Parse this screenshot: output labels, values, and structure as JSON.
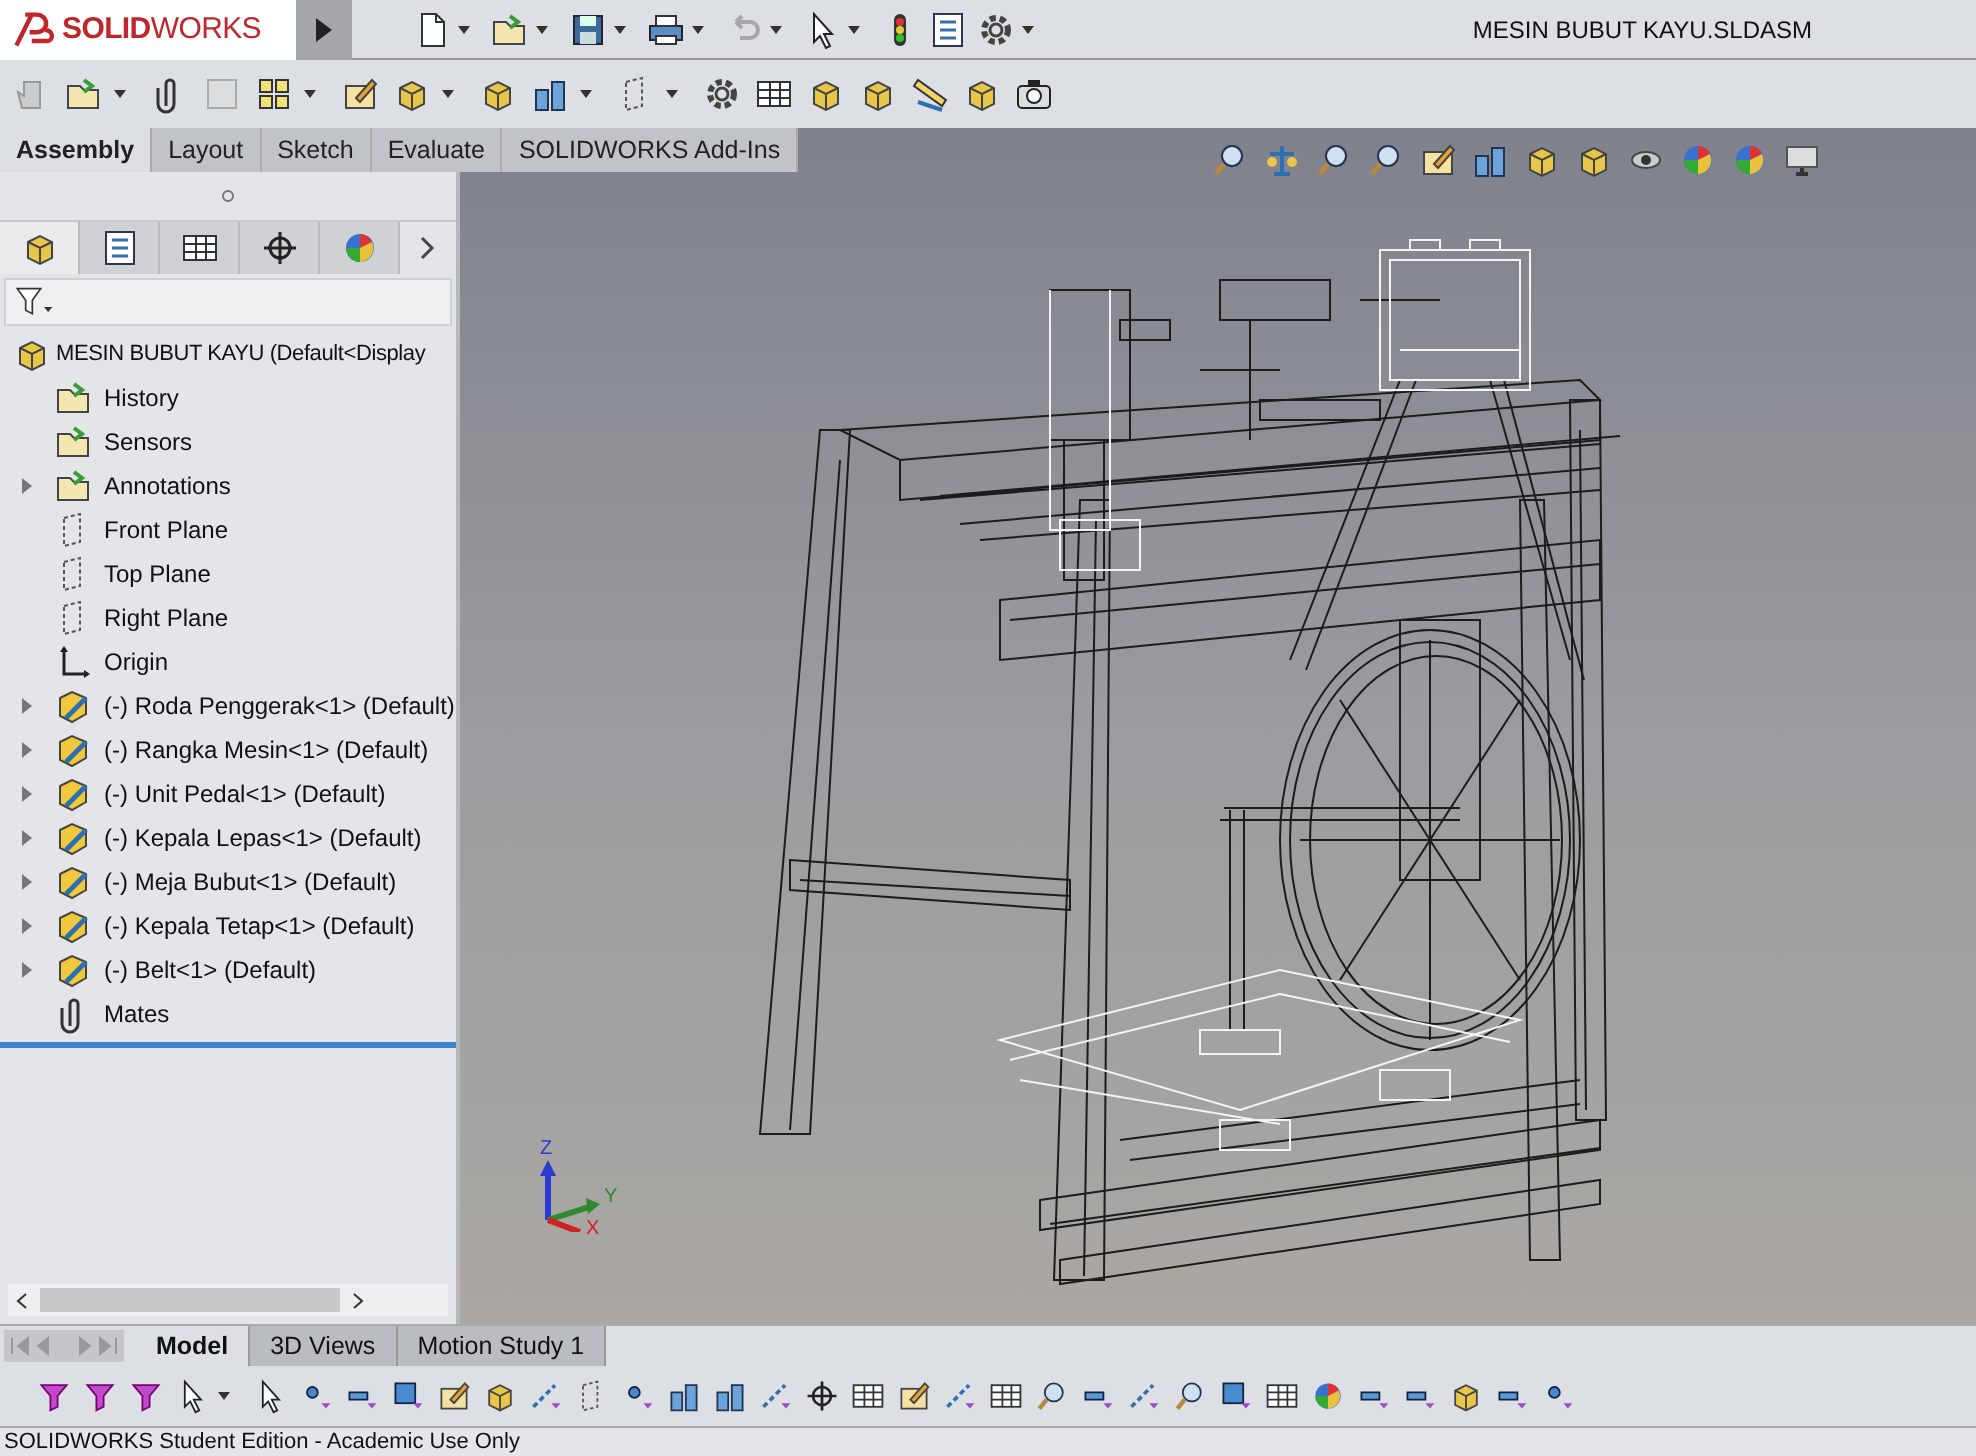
{
  "app": {
    "logo": "**SOLID**WORKS"
  },
  "window": {
    "title": "MESIN BUBUT KAYU.SLDASM"
  },
  "command_tabs": [
    {
      "label": "Assembly",
      "selected": true
    },
    {
      "label": "Layout",
      "selected": false
    },
    {
      "label": "Sketch",
      "selected": false
    },
    {
      "label": "Evaluate",
      "selected": false
    },
    {
      "label": "SOLIDWORKS Add-Ins",
      "selected": false
    }
  ],
  "panel_tabs": [
    {
      "kind": "feature",
      "selected": true
    },
    {
      "kind": "property",
      "selected": false
    },
    {
      "kind": "config",
      "selected": false
    },
    {
      "kind": "dimxpert",
      "selected": false
    },
    {
      "kind": "display",
      "selected": false
    }
  ],
  "tree": {
    "root": "MESIN BUBUT KAYU  (Default<Display",
    "items": [
      {
        "kind": "history",
        "label": "History",
        "expandable": false
      },
      {
        "kind": "sensors",
        "label": "Sensors",
        "expandable": false
      },
      {
        "kind": "annotations",
        "label": "Annotations",
        "expandable": true
      },
      {
        "kind": "plane",
        "label": "Front Plane",
        "expandable": false
      },
      {
        "kind": "plane",
        "label": "Top Plane",
        "expandable": false
      },
      {
        "kind": "plane",
        "label": "Right Plane",
        "expandable": false
      },
      {
        "kind": "origin",
        "label": "Origin",
        "expandable": false
      },
      {
        "kind": "component",
        "label": "(-) Roda Penggerak<1> (Default)",
        "expandable": true
      },
      {
        "kind": "component",
        "label": "(-) Rangka Mesin<1> (Default)",
        "expandable": true
      },
      {
        "kind": "component",
        "label": "(-) Unit Pedal<1> (Default)",
        "expandable": true
      },
      {
        "kind": "component",
        "label": "(-) Kepala Lepas<1> (Default)",
        "expandable": true
      },
      {
        "kind": "component",
        "label": "(-) Meja Bubut<1> (Default)",
        "expandable": true
      },
      {
        "kind": "component",
        "label": "(-) Kepala Tetap<1> (Default)",
        "expandable": true
      },
      {
        "kind": "component",
        "label": "(-) Belt<1> (Default)",
        "expandable": true
      },
      {
        "kind": "mates",
        "label": "Mates",
        "expandable": false
      }
    ]
  },
  "triad": {
    "axes": [
      "Z",
      "Y",
      "X"
    ]
  },
  "bottom_tabs": [
    {
      "label": "Model",
      "selected": true
    },
    {
      "label": "3D Views",
      "selected": false
    },
    {
      "label": "Motion Study 1",
      "selected": false
    }
  ],
  "status_bar": {
    "text": "SOLIDWORKS Student Edition - Academic Use Only"
  }
}
